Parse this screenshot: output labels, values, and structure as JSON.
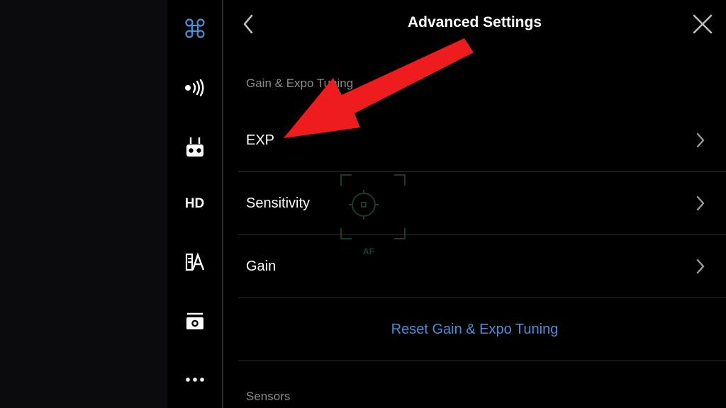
{
  "header": {
    "title": "Advanced Settings"
  },
  "sidebar": {
    "items": [
      {
        "icon": "drone-icon",
        "active": true
      },
      {
        "icon": "signal-icon"
      },
      {
        "icon": "remote-controller-icon"
      },
      {
        "icon": "hd-icon",
        "label": "HD"
      },
      {
        "icon": "battery-icon"
      },
      {
        "icon": "camera-icon"
      },
      {
        "icon": "more-icon"
      }
    ]
  },
  "sections": {
    "gain_expo": {
      "label": "Gain & Expo Tuning",
      "rows": [
        {
          "label": "EXP"
        },
        {
          "label": "Sensitivity"
        },
        {
          "label": "Gain"
        }
      ],
      "reset_label": "Reset Gain & Expo Tuning"
    },
    "sensors": {
      "label": "Sensors"
    }
  },
  "overlay": {
    "af_label": "AF"
  },
  "colors": {
    "accent": "#4a90d9",
    "annotation_arrow": "#ee1c1c",
    "divider": "#2b2b2e",
    "muted_text": "#8b8b8f"
  }
}
